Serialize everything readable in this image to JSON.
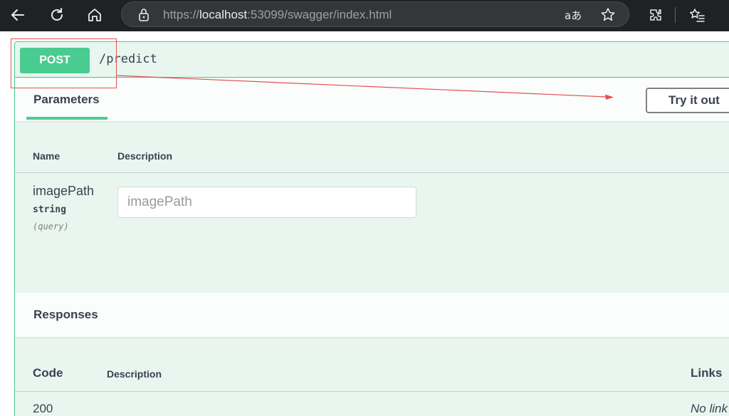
{
  "browser": {
    "url_scheme": "https://",
    "url_host": "localhost",
    "url_rest": ":53099/swagger/index.html",
    "read_aloud_label": "aあ"
  },
  "operation": {
    "method": "POST",
    "path": "/predict",
    "method_color": "#49cc90"
  },
  "parameters": {
    "tab_label": "Parameters",
    "try_button": "Try it out",
    "col_name": "Name",
    "col_description": "Description",
    "items": [
      {
        "name": "imagePath",
        "type": "string",
        "in": "(query)",
        "placeholder": "imagePath"
      }
    ]
  },
  "responses": {
    "title": "Responses",
    "col_code": "Code",
    "col_description": "Description",
    "col_links": "Links",
    "rows": [
      {
        "code": "200",
        "links": "No link"
      }
    ]
  },
  "colors": {
    "accent": "#49cc90",
    "background_tint": "#e8f6ef",
    "annotation": "#e05252"
  }
}
